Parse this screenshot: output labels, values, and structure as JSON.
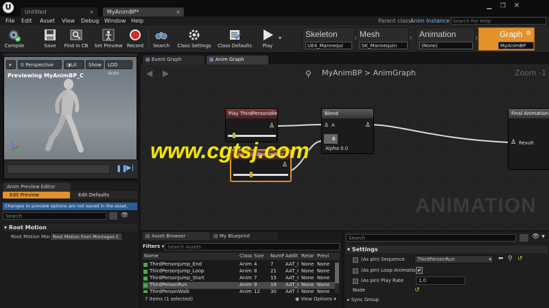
{
  "window": {
    "tabs": [
      {
        "label": "Untitled"
      },
      {
        "label": "MyAnimBP*"
      }
    ],
    "parent_class_label": "Parent class:",
    "parent_class_value": "Anim Instance",
    "search_help_placeholder": "Search For Help"
  },
  "menu": [
    "File",
    "Edit",
    "Asset",
    "View",
    "Debug",
    "Window",
    "Help"
  ],
  "toolbar": {
    "compile": "Compile",
    "save": "Save",
    "find_in_cb": "Find in CB",
    "set_preview": "Set Preview",
    "record": "Record",
    "search": "Search",
    "class_settings": "Class Settings",
    "class_defaults": "Class Defaults",
    "play": "Play"
  },
  "modes": {
    "skeleton": {
      "label": "Skeleton",
      "value": "UE4_Mannequi"
    },
    "mesh": {
      "label": "Mesh",
      "value": "SK_Mannequin"
    },
    "animation": {
      "label": "Animation",
      "value": "(None)"
    },
    "graph": {
      "label": "Graph",
      "value": "MyAnimBP"
    }
  },
  "viewport": {
    "perspective": "Perspective",
    "lit": "Lit",
    "show": "Show",
    "lod": "LOD Auto",
    "previewing": "Previewing MyAnimBP_C"
  },
  "preview_editor": {
    "tab_label": "Anim Preview Editor",
    "edit_preview": "Edit Preview",
    "edit_defaults": "Edit Defaults",
    "warning": "Changes to preview options are not saved in the asset.",
    "search_placeholder": "Search",
    "section": "Root Motion",
    "root_motion_label": "Root Motion Moc",
    "root_motion_value": "Root Motion from Montages C"
  },
  "graph_tabs": [
    {
      "label": "Event Graph"
    },
    {
      "label": "Anim Graph"
    }
  ],
  "graph": {
    "breadcrumb_root": "MyAnimBP",
    "breadcrumb_sep": ">",
    "breadcrumb_leaf": "AnimGraph",
    "zoom": "Zoom -1",
    "watermark": "ANIMATION",
    "overlay_text": "www.cgtsj.com",
    "nodes": {
      "play_idle": "Play ThirdPersonIdle",
      "blend": "Blend",
      "blend_a": "A",
      "blend_b": "B",
      "blend_alpha": "Alpha 0.0",
      "play_run": "Play ThirdPersonRun",
      "final_pose": "Final Animation P",
      "result": "Result"
    }
  },
  "asset_browser": {
    "tabs": [
      {
        "label": "Asset Browser"
      },
      {
        "label": "My Blueprint"
      }
    ],
    "filters": "Filters",
    "search_placeholder": "Search Assets",
    "columns": [
      "Name",
      "Class",
      "Size",
      "NumF",
      "Addit",
      "Retar",
      "Previ"
    ],
    "rows": [
      [
        "ThirdPersonJump_End",
        "Anim",
        "4",
        "7",
        "AAT_I",
        "None",
        "None"
      ],
      [
        "ThirdPersonJump_Loop",
        "Anim",
        "8",
        "21",
        "AAT_I",
        "None",
        "None"
      ],
      [
        "ThirdPersonJump_Start",
        "Anim",
        "7",
        "15",
        "AAT_I",
        "None",
        "None"
      ],
      [
        "ThirdPersonRun",
        "Anim",
        "9",
        "19",
        "AAT_I",
        "None",
        "None"
      ],
      [
        "ThirdPersonWalk",
        "Anim",
        "12",
        "30",
        "AAT_I",
        "None",
        "None"
      ]
    ],
    "status": "7 items (1 selected)",
    "view_options": "View Options"
  },
  "details": {
    "search_placeholder": "Search",
    "section_settings": "Settings",
    "props": [
      {
        "label": "(As pin) Sequence",
        "value": "ThirdPersonRun"
      },
      {
        "label": "(As pin) Loop Animation",
        "value": "✔"
      },
      {
        "label": "(As pin) Play Rate",
        "value": "1.0"
      }
    ],
    "node_label": "Node",
    "section_sync": "Sync Group"
  }
}
